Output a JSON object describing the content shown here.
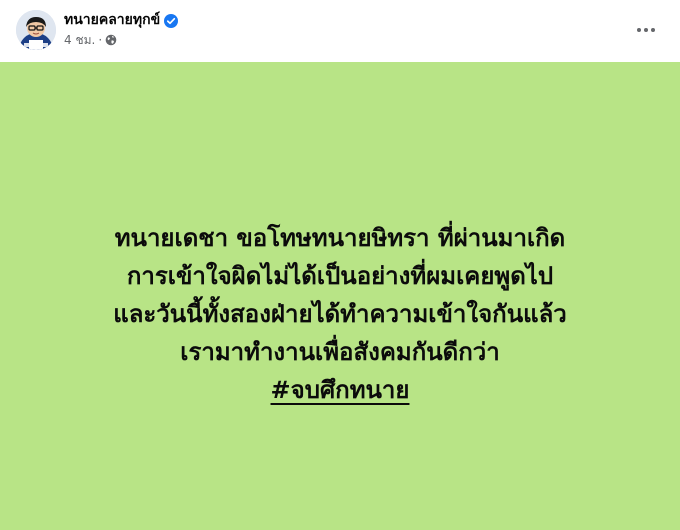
{
  "author": {
    "name": "ทนายคลายทุกข์",
    "avatar_icon": "profile-photo",
    "verified_icon": "verified-badge-icon"
  },
  "meta": {
    "time": "4 ชม.",
    "separator": "·",
    "audience_icon": "globe-icon"
  },
  "actions": {
    "more_icon": "more-horizontal-icon"
  },
  "post": {
    "background_color": "#b8e486",
    "lines": [
      "ทนายเดชา ขอโทษทนายษิทรา ที่ผ่านมาเกิด",
      "การเข้าใจผิดไม่ได้เป็นอย่างที่ผมเคยพูดไป",
      "และวันนี้ทั้งสองฝ่ายได้ทำความเข้าใจกันแล้ว",
      "เรามาทำงานเพื่อสังคมกันดีกว่า"
    ],
    "hashtag": "#จบศึกทนาย"
  }
}
